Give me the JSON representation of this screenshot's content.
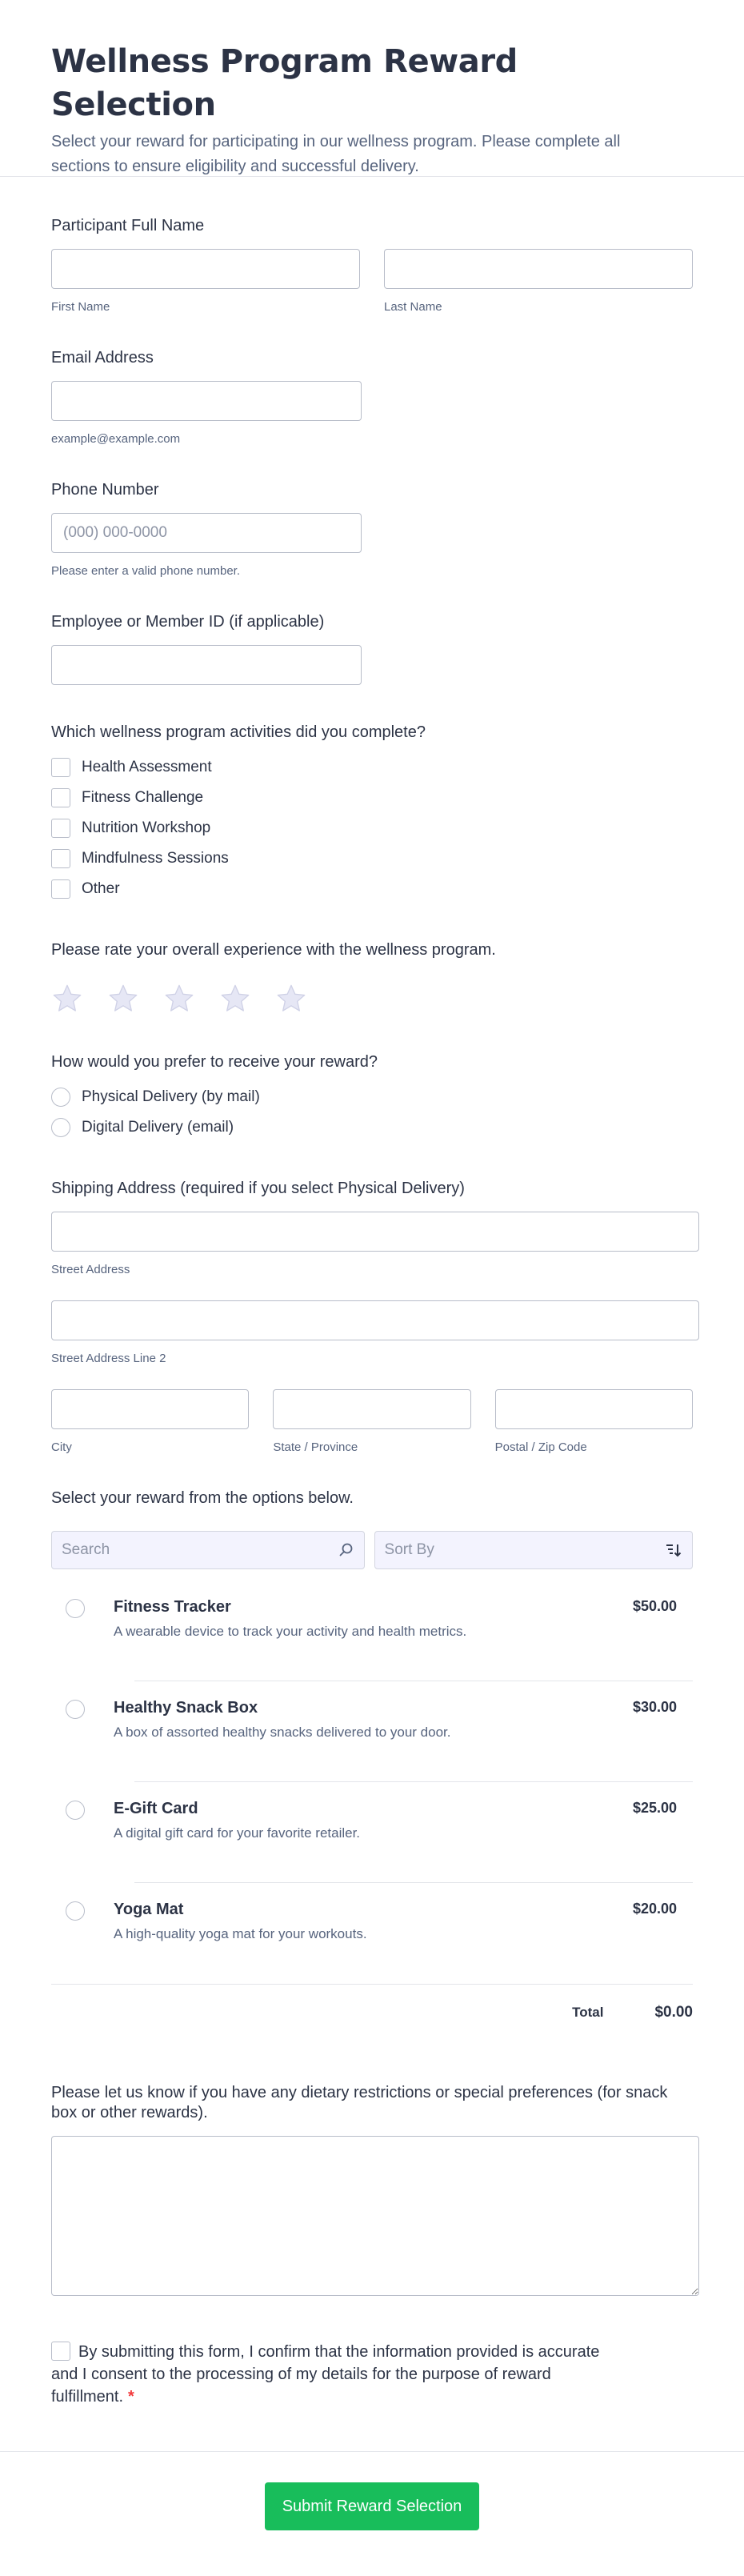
{
  "header": {
    "title": "Wellness Program Reward Selection",
    "description": "Select your reward for participating in our wellness program. Please complete all sections to ensure eligibility and successful delivery."
  },
  "name": {
    "label": "Participant Full Name",
    "first_sub": "First Name",
    "last_sub": "Last Name"
  },
  "email": {
    "label": "Email Address",
    "sub": "example@example.com"
  },
  "phone": {
    "label": "Phone Number",
    "placeholder": "(000) 000-0000",
    "sub": "Please enter a valid phone number."
  },
  "member_id": {
    "label": "Employee or Member ID (if applicable)"
  },
  "activities": {
    "label": "Which wellness program activities did you complete?",
    "options": [
      "Health Assessment",
      "Fitness Challenge",
      "Nutrition Workshop",
      "Mindfulness Sessions",
      "Other"
    ]
  },
  "rating": {
    "label": "Please rate your overall experience with the wellness program.",
    "max": 5,
    "value": 0
  },
  "delivery": {
    "label": "How would you prefer to receive your reward?",
    "options": [
      "Physical Delivery (by mail)",
      "Digital Delivery (email)"
    ]
  },
  "address": {
    "label": "Shipping Address (required if you select Physical Delivery)",
    "street_sub": "Street Address",
    "street2_sub": "Street Address Line 2",
    "city_sub": "City",
    "state_sub": "State / Province",
    "zip_sub": "Postal / Zip Code"
  },
  "rewards": {
    "label": "Select your reward from the options below.",
    "search_placeholder": "Search",
    "sort_label": "Sort By",
    "products": [
      {
        "name": "Fitness Tracker",
        "desc": "A wearable device to track your activity and health metrics.",
        "price": "$50.00"
      },
      {
        "name": "Healthy Snack Box",
        "desc": "A box of assorted healthy snacks delivered to your door.",
        "price": "$30.00"
      },
      {
        "name": "E-Gift Card",
        "desc": "A digital gift card for your favorite retailer.",
        "price": "$25.00"
      },
      {
        "name": "Yoga Mat",
        "desc": "A high-quality yoga mat for your workouts.",
        "price": "$20.00"
      }
    ],
    "total_label": "Total",
    "total_value": "$0.00"
  },
  "dietary": {
    "label": "Please let us know if you have any dietary restrictions or special preferences (for snack box or other rewards)."
  },
  "consent": {
    "text": "By submitting this form, I confirm that the information provided is accurate and I consent to the processing of my details for the purpose of reward fulfillment.",
    "required_mark": "*"
  },
  "submit_label": "Submit Reward Selection",
  "colors": {
    "accent": "#18bd5b",
    "star": "#e6e7f5",
    "required": "#f23a3c"
  }
}
